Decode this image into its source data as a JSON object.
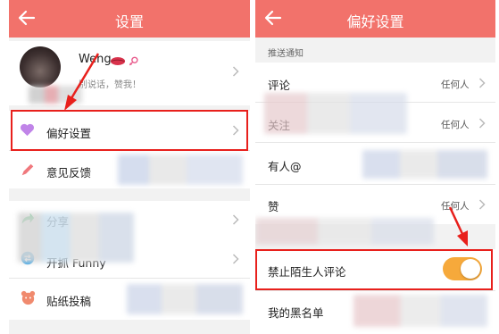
{
  "left": {
    "header": {
      "title": "设置"
    },
    "profile": {
      "name": "Weng",
      "signature": "别说话，赞我！"
    },
    "items": [
      {
        "label": "偏好设置"
      },
      {
        "label": "意见反馈"
      },
      {
        "label": "分享"
      },
      {
        "label": "开抓 Funny"
      },
      {
        "label": "贴纸投稿"
      }
    ]
  },
  "right": {
    "header": {
      "title": "偏好设置"
    },
    "section": {
      "title": "推送通知"
    },
    "items": [
      {
        "label": "评论",
        "value": "任何人"
      },
      {
        "label": "关注",
        "value": "任何人"
      },
      {
        "label": "有人@",
        "value": ""
      },
      {
        "label": "赞",
        "value": "任何人"
      },
      {
        "label": "禁止陌生人评论",
        "value": ""
      },
      {
        "label": "我的黑名单",
        "value": ""
      }
    ],
    "toggle": {
      "on": true
    }
  },
  "colors": {
    "header": "#f2726b",
    "highlight_box": "#e8201c",
    "toggle_on": "#f6a93b",
    "heart_icon": "#c084e8",
    "pencil_icon": "#f0787d",
    "share_icon": "#3cc46b",
    "bear_icon": "#f08a6e"
  }
}
